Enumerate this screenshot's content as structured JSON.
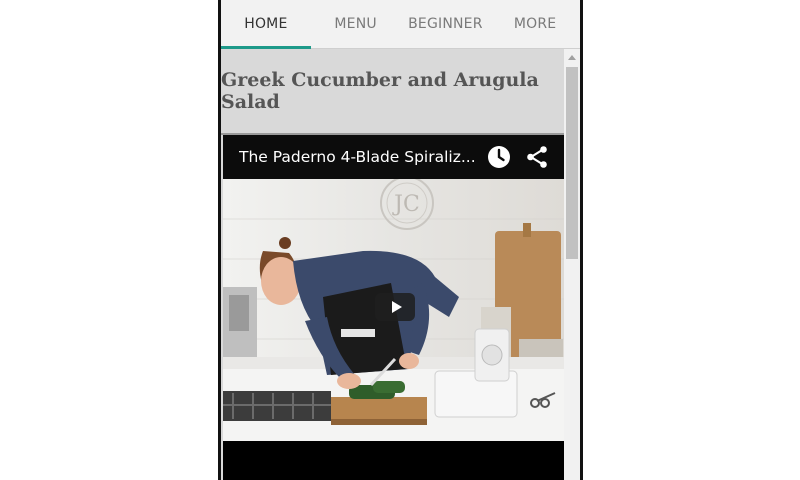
{
  "tabs": [
    {
      "label": "HOME",
      "active": true
    },
    {
      "label": "MENU",
      "active": false
    },
    {
      "label": "BEGINNER",
      "active": false
    },
    {
      "label": "MORE",
      "active": false
    }
  ],
  "recipe": {
    "title": "Greek Cucumber and Arugula Salad"
  },
  "video": {
    "title": "The Paderno 4-Blade Spiraliz...",
    "icons": [
      "clock-icon",
      "share-icon",
      "play-icon"
    ],
    "logo_text": "JC"
  },
  "colors": {
    "tab_indicator": "#1e9a8a",
    "content_background": "#d9d9d9",
    "tab_bar_background": "#f2f2f2"
  }
}
